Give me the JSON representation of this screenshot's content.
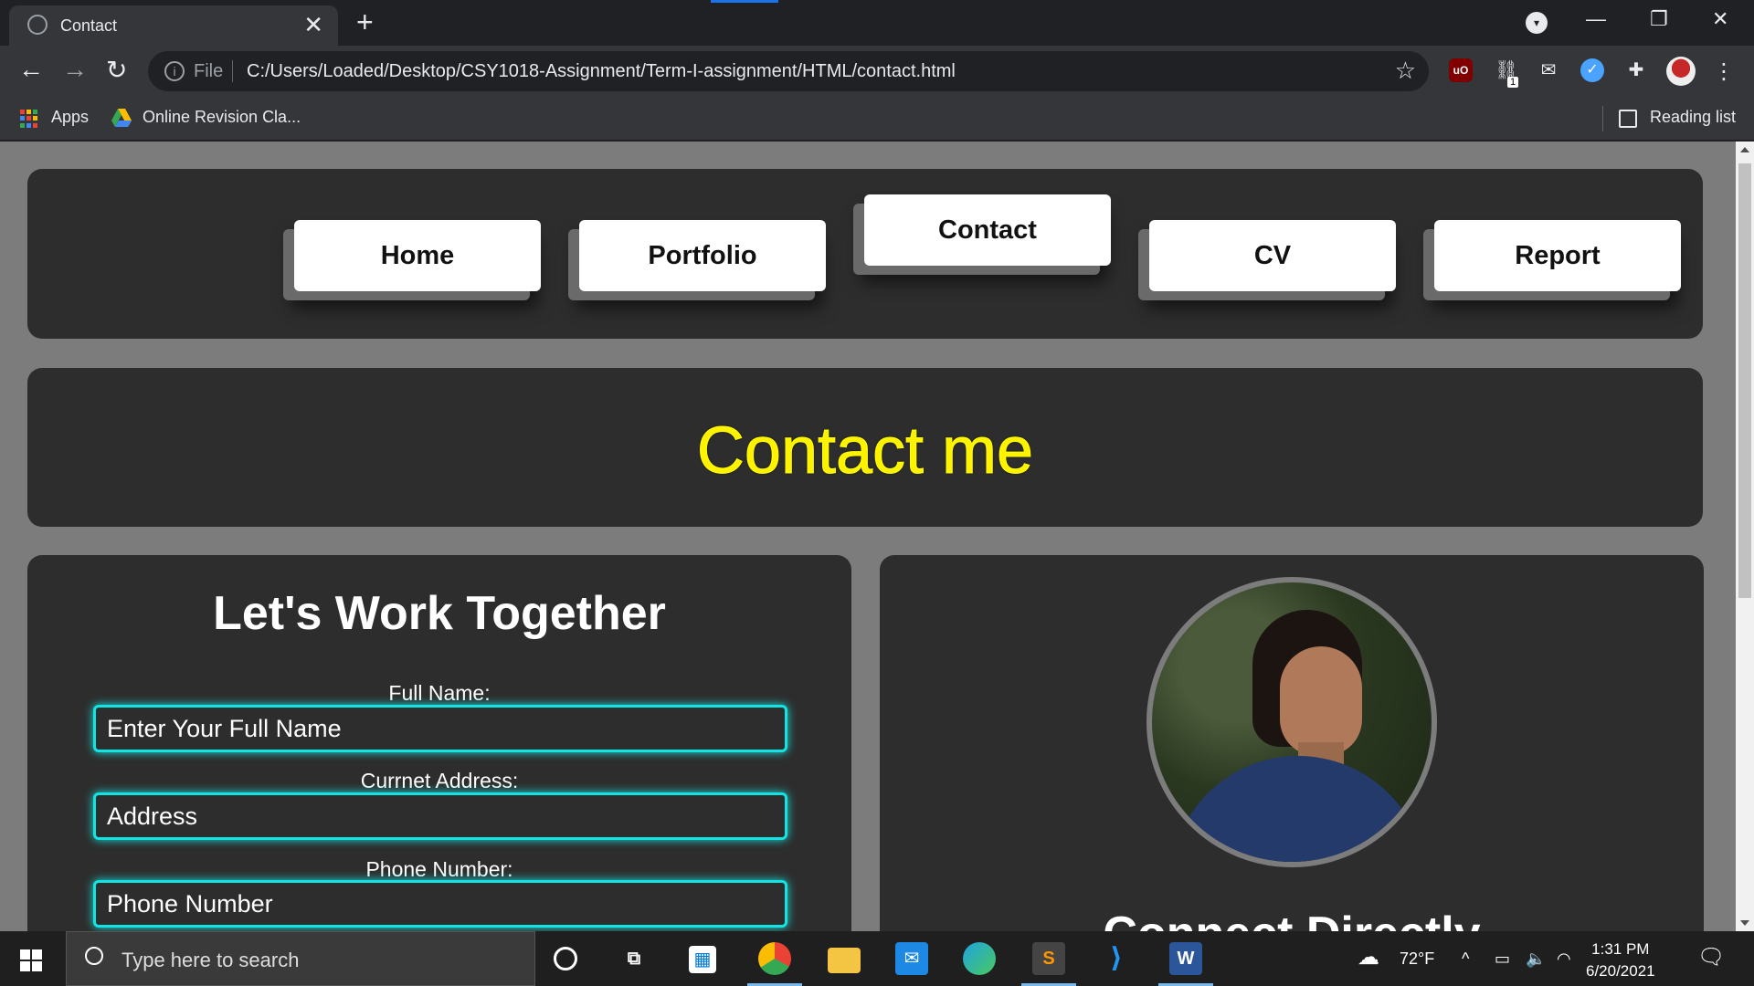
{
  "browser": {
    "tab_title": "Contact",
    "tab_close": "✕",
    "new_tab": "+",
    "window_controls": {
      "minimize": "—",
      "restore": "❐",
      "close": "✕"
    },
    "back": "←",
    "forward": "→",
    "reload": "↻",
    "info": "i",
    "file_label": "File",
    "url": "C:/Users/Loaded/Desktop/CSY1018-Assignment/Term-I-assignment/HTML/contact.html",
    "star": "☆",
    "ext_ublock": "uO",
    "ext_badge": "1",
    "menu": "⋮"
  },
  "bookmarks": {
    "apps": "Apps",
    "online_revision": "Online Revision Cla...",
    "reading_list": "Reading list"
  },
  "page": {
    "nav": {
      "items": [
        {
          "label": "Home"
        },
        {
          "label": "Portfolio"
        },
        {
          "label": "Contact"
        },
        {
          "label": "CV"
        },
        {
          "label": "Report"
        }
      ],
      "active_index": 2
    },
    "heading": "Contact me",
    "form": {
      "title": "Let's Work Together",
      "fields": [
        {
          "label": "Full Name:",
          "placeholder": "Enter Your Full Name"
        },
        {
          "label": "Currnet Address:",
          "placeholder": "Address"
        },
        {
          "label": "Phone Number:",
          "placeholder": "Phone Number"
        }
      ]
    },
    "profile": {
      "connect_title": "Connect Directly"
    },
    "colors": {
      "heading": "#fff200",
      "input_border": "#14e3e3",
      "panel": "#2d2d2d",
      "background": "#7c7c7c"
    }
  },
  "taskbar": {
    "search_placeholder": "Type here to search",
    "weather": "72°F",
    "time": "1:31 PM",
    "date": "6/20/2021"
  }
}
